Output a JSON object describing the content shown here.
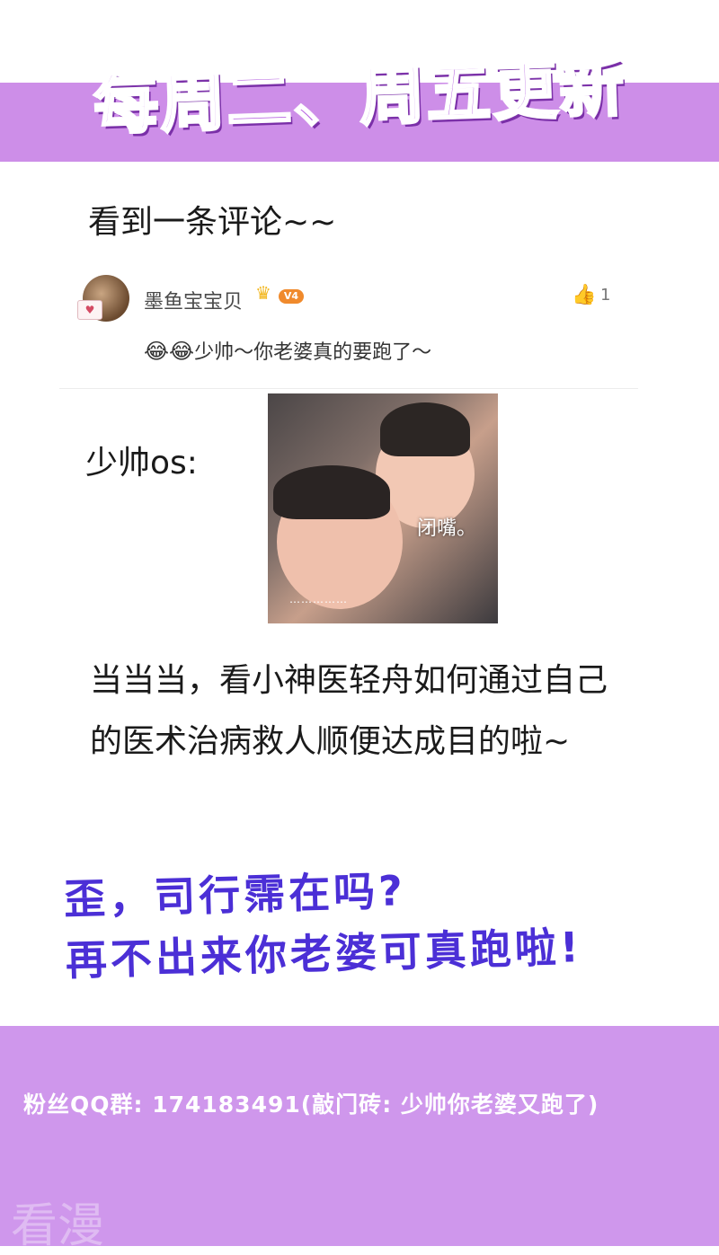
{
  "banner": {
    "title": "每周二、周五更新"
  },
  "intro_text": "看到一条评论~~",
  "comment": {
    "avatar_badge": "♥",
    "username": "墨鱼宝宝贝",
    "crown": "♛",
    "level": "V4",
    "like_icon": "thumbs-up-icon",
    "like_glyph": "👍",
    "like_count": "1",
    "emoji": "😂😂",
    "text": "少帅～你老婆真的要跑了～"
  },
  "os_label": "少帅os:",
  "photo": {
    "caption": "闭嘴。",
    "dots": "……………"
  },
  "body_text": "当当当，看小神医轻舟如何通过自己的医术治病救人顺便达成目的啦~",
  "callout": {
    "line1": "歪，司行霈在吗?",
    "line2": "再不出来你老婆可真跑啦!"
  },
  "footer": {
    "text": "粉丝QQ群: 174183491(敲门砖: 少帅你老婆又跑了)",
    "watermark": "看漫"
  },
  "colors": {
    "banner_bg": "#cd8ee8",
    "callout_text": "#4b2fd6",
    "footer_bg": "#cf97ec"
  }
}
